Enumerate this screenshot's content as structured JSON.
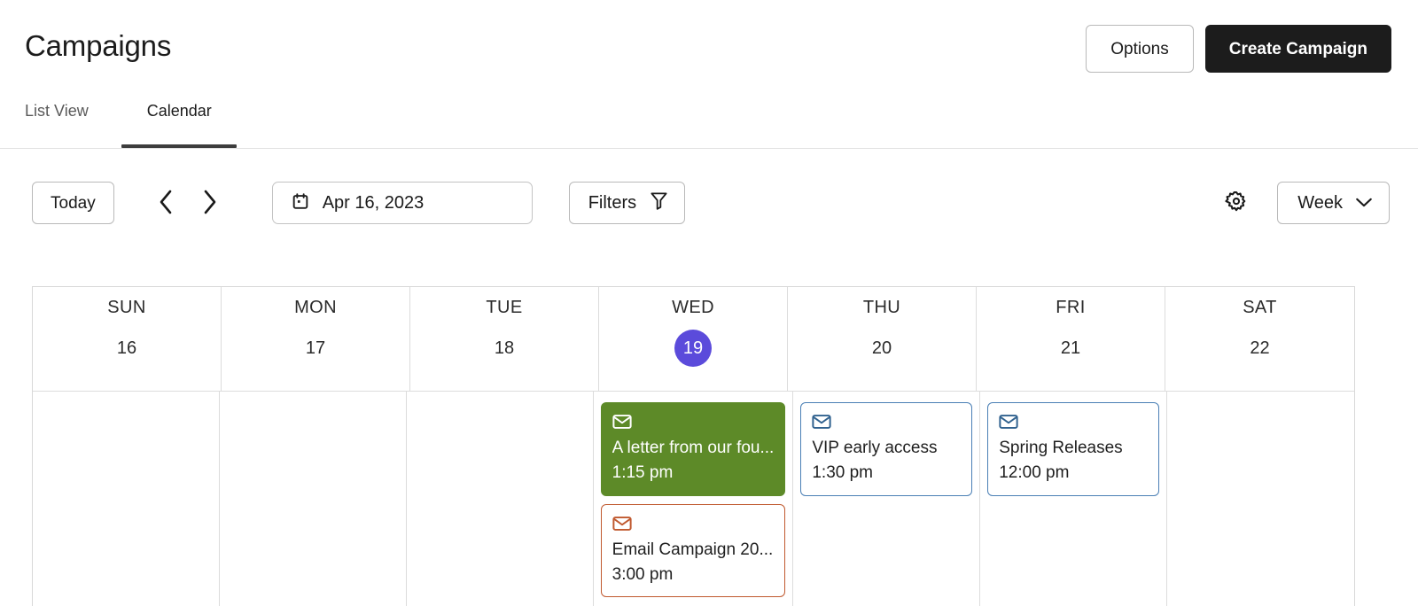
{
  "header": {
    "title": "Campaigns",
    "options_label": "Options",
    "create_label": "Create Campaign"
  },
  "tabs": [
    {
      "label": "List View",
      "active": false
    },
    {
      "label": "Calendar",
      "active": true
    }
  ],
  "toolbar": {
    "today_label": "Today",
    "prev_icon": "chevron-left-icon",
    "next_icon": "chevron-right-icon",
    "date_icon": "calendar-icon",
    "date_value": "Apr 16, 2023",
    "filters_label": "Filters",
    "filters_icon": "funnel-icon",
    "settings_icon": "gear-icon",
    "view_label": "Week",
    "view_chevron_icon": "chevron-down-icon"
  },
  "calendar": {
    "today_badge_color": "#5b4bdb",
    "days": [
      {
        "dow": "SUN",
        "num": "16",
        "today": false
      },
      {
        "dow": "MON",
        "num": "17",
        "today": false
      },
      {
        "dow": "TUE",
        "num": "18",
        "today": false
      },
      {
        "dow": "WED",
        "num": "19",
        "today": true
      },
      {
        "dow": "THU",
        "num": "20",
        "today": false
      },
      {
        "dow": "FRI",
        "num": "21",
        "today": false
      },
      {
        "dow": "SAT",
        "num": "22",
        "today": false
      }
    ],
    "events": {
      "sun": [],
      "mon": [],
      "tue": [],
      "wed": [
        {
          "title": "A letter from our fou...",
          "time": "1:15 pm",
          "style": "green",
          "icon": "envelope-icon",
          "color": "#5d8a28"
        },
        {
          "title": "Email Campaign 20...",
          "time": "3:00 pm",
          "style": "outline-red",
          "icon": "envelope-icon",
          "color": "#c0592f"
        }
      ],
      "thu": [
        {
          "title": "VIP early access",
          "time": "1:30 pm",
          "style": "outline-blue",
          "icon": "envelope-icon",
          "color": "#4a7fb5"
        }
      ],
      "fri": [
        {
          "title": "Spring Releases",
          "time": "12:00 pm",
          "style": "outline-blue",
          "icon": "envelope-icon",
          "color": "#4a7fb5"
        }
      ],
      "sat": []
    }
  }
}
